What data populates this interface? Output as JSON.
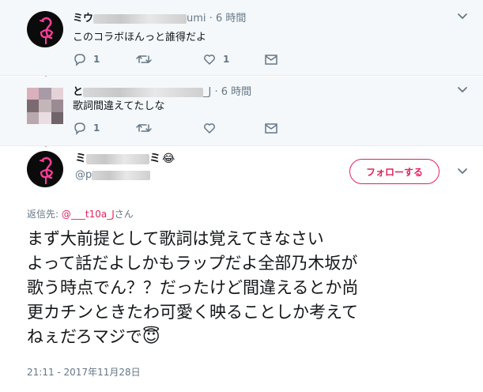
{
  "tweets": [
    {
      "name_prefix": "ミウ",
      "handle_suffix": "umi",
      "separator": "·",
      "time": "6 時間",
      "text": "このコラボほんっと誰得だよ",
      "reply_count": "1",
      "like_count": "1"
    },
    {
      "name_prefix": "と",
      "handle_suffix": "_J",
      "separator": "·",
      "time": "6 時間",
      "text": "歌詞間違えてたしな",
      "reply_count": "1",
      "like_count": ""
    }
  ],
  "main_tweet": {
    "name_start": "ミ",
    "name_end": "ミ",
    "name_emoji": "😂",
    "handle_prefix": "@p",
    "follow_label": "フォローする",
    "reply_to_label": "返信先:",
    "reply_to_user": "@___t10a_J",
    "reply_to_suffix": "さん",
    "text": "まず大前提として歌詞は覚えてきなさい\nよって話だよしかもラップだよ全部乃木坂が\n歌う時点でん？？だったけど間違えるとか尚\n更カチンときたわ可愛く映ることしか考えて\nねぇだろマジで",
    "text_emoji": "😇",
    "timestamp": "21:11 - 2017年11月28日"
  },
  "icons": {
    "reply": "reply-icon",
    "retweet": "retweet-icon",
    "like": "heart-icon",
    "dm": "envelope-icon",
    "caret": "chevron-down-icon",
    "avatar_flamingo": "flamingo-avatar"
  },
  "colors": {
    "accent": "#e0245e",
    "muted": "#657786",
    "thread_line": "#e1a3b3",
    "reply_bg": "#f5f8fa"
  }
}
